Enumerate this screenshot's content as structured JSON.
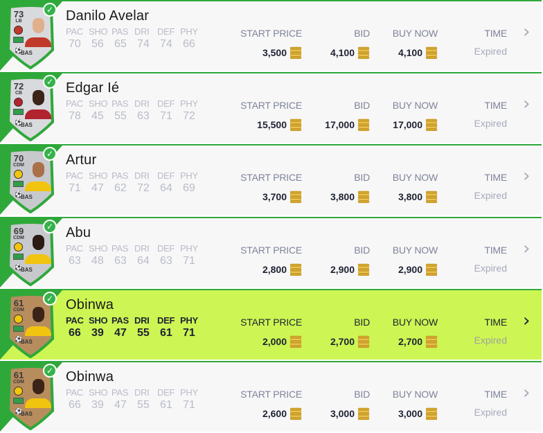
{
  "headers": {
    "start_price": "START PRICE",
    "bid": "BID",
    "buy_now": "BUY NOW",
    "time": "TIME"
  },
  "stat_labels": [
    "PAC",
    "SHO",
    "PAS",
    "DRI",
    "DEF",
    "PHY"
  ],
  "rows": [
    {
      "name": "Danilo Avelar",
      "rating": "73",
      "position": "LB",
      "chem": "BAS",
      "stats": [
        "70",
        "56",
        "65",
        "74",
        "74",
        "66"
      ],
      "start_price": "3,500",
      "bid": "4,100",
      "buy_now": "4,100",
      "time": "Expired",
      "card_color": "#d9dade",
      "card_edge": "#2fa83a",
      "skin": "#e0b08c",
      "shirt": "#c0392b",
      "selected": false
    },
    {
      "name": "Edgar Ié",
      "rating": "72",
      "position": "CB",
      "chem": "BAS",
      "stats": [
        "78",
        "45",
        "55",
        "63",
        "71",
        "72"
      ],
      "start_price": "15,500",
      "bid": "17,000",
      "buy_now": "17,000",
      "time": "Expired",
      "card_color": "#d9dade",
      "card_edge": "#2fa83a",
      "skin": "#3b2418",
      "shirt": "#b0232f",
      "selected": false
    },
    {
      "name": "Artur",
      "rating": "70",
      "position": "CDM",
      "chem": "BAS",
      "stats": [
        "71",
        "47",
        "62",
        "72",
        "64",
        "69"
      ],
      "start_price": "3,700",
      "bid": "3,800",
      "buy_now": "3,800",
      "time": "Expired",
      "card_color": "#c8c9cd",
      "card_edge": "#2fa83a",
      "skin": "#a9704a",
      "shirt": "#f1c40f",
      "selected": false
    },
    {
      "name": "Abu",
      "rating": "69",
      "position": "CDM",
      "chem": "BAS",
      "stats": [
        "63",
        "48",
        "63",
        "64",
        "63",
        "71"
      ],
      "start_price": "2,800",
      "bid": "2,900",
      "buy_now": "2,900",
      "time": "Expired",
      "card_color": "#c8c9cd",
      "card_edge": "#2fa83a",
      "skin": "#2b1b13",
      "shirt": "#f1c40f",
      "selected": false
    },
    {
      "name": "Obinwa",
      "rating": "61",
      "position": "CDM",
      "chem": "BAS",
      "stats": [
        "66",
        "39",
        "47",
        "55",
        "61",
        "71"
      ],
      "start_price": "2,000",
      "bid": "2,700",
      "buy_now": "2,700",
      "time": "Expired",
      "card_color": "#b88d5e",
      "card_edge": "#2fa83a",
      "skin": "#3a2418",
      "shirt": "#f1c40f",
      "selected": true
    },
    {
      "name": "Obinwa",
      "rating": "61",
      "position": "CDM",
      "chem": "BAS",
      "stats": [
        "66",
        "39",
        "47",
        "55",
        "61",
        "71"
      ],
      "start_price": "2,600",
      "bid": "3,000",
      "buy_now": "3,000",
      "time": "Expired",
      "card_color": "#b88d5e",
      "card_edge": "#2fa83a",
      "skin": "#3a2418",
      "shirt": "#f1c40f",
      "selected": false
    }
  ],
  "icons": {
    "coin": "coin-stack-icon",
    "check": "check-icon",
    "chevron": "chevron-right-icon"
  },
  "colors": {
    "accent_green": "#2fa83a",
    "selected_row": "#cdf553",
    "coin_gold": "#e0b23a"
  }
}
